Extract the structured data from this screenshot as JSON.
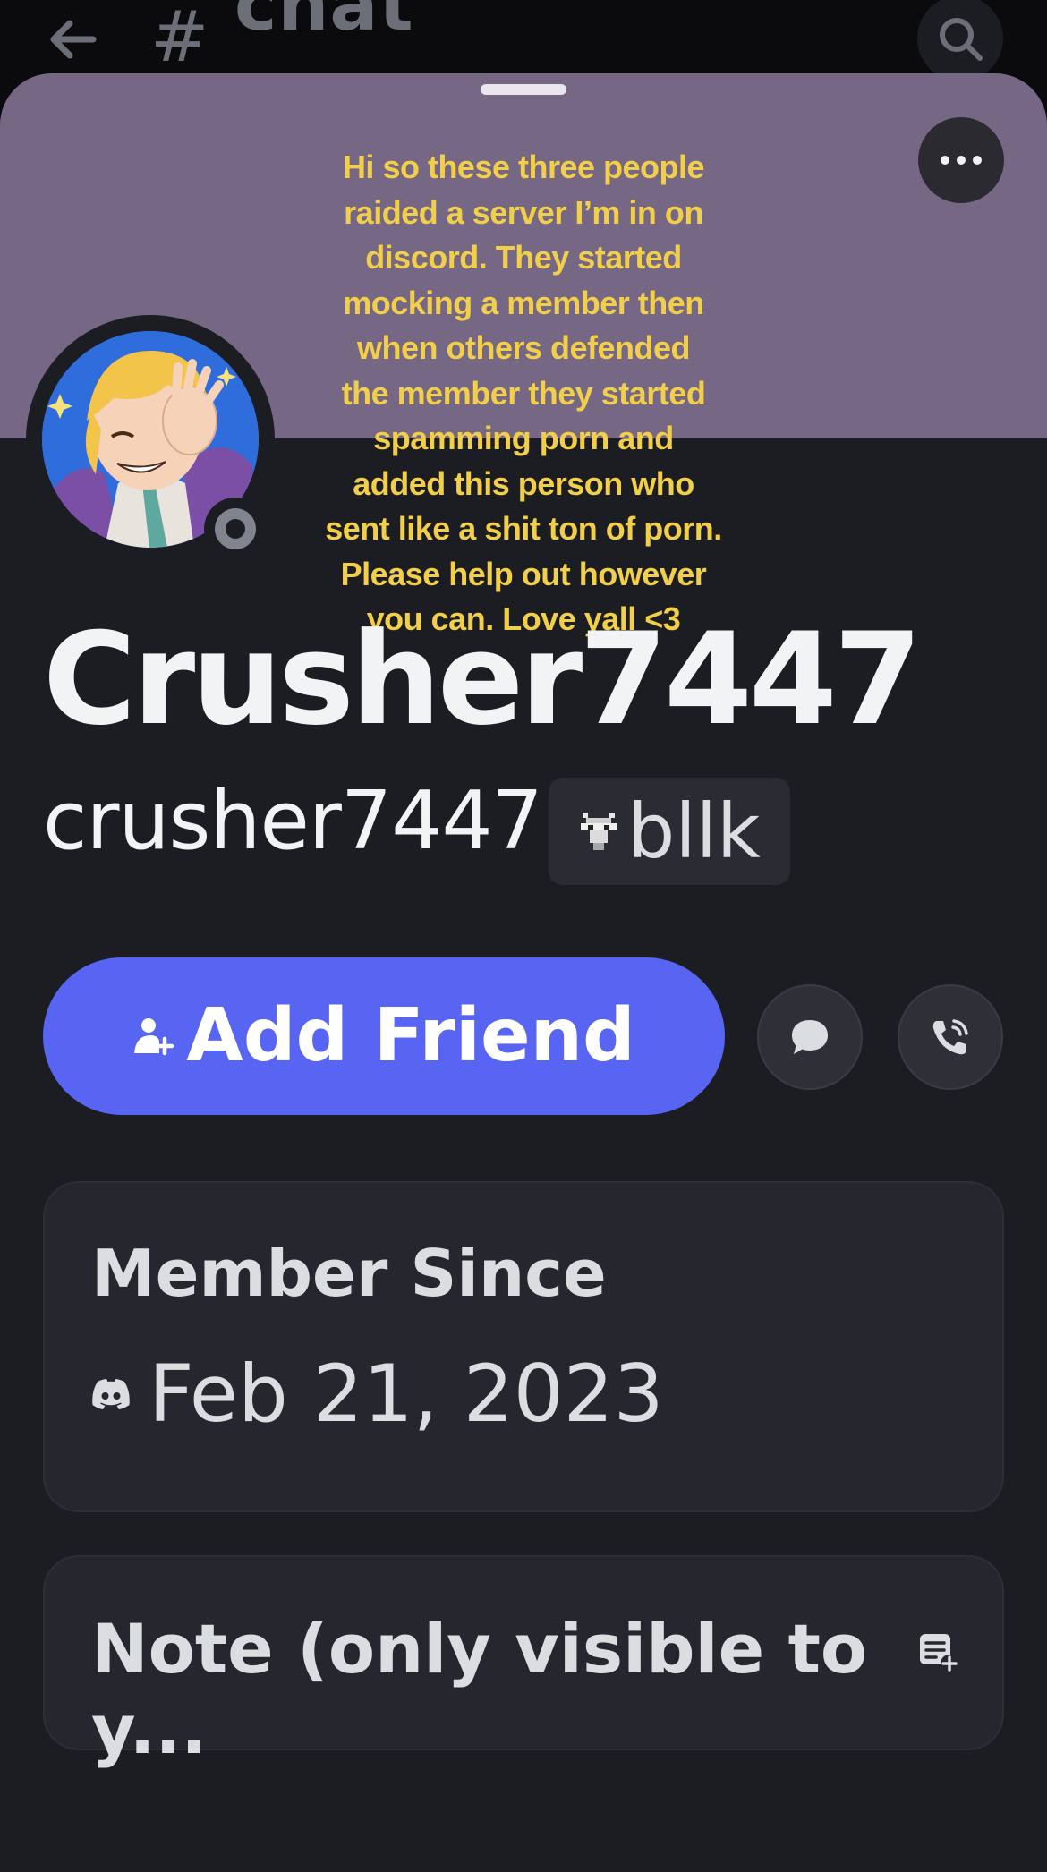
{
  "header": {
    "channel_symbol": "#",
    "channel_name": "chat"
  },
  "overlay_caption": "Hi so these three people\nraided a server I’m in on\ndiscord. They started\nmocking a member then\nwhen others defended\nthe member they started\nspamming porn and\nadded this person who\nsent like a shit ton of porn.\nPlease help out however\nyou can. Love yall <3",
  "profile": {
    "display_name": "Crusher7447",
    "username": "crusher7447",
    "tag_label": "bllk",
    "tag_icon": "goat-icon",
    "status": "offline",
    "banner_color": "#766884"
  },
  "actions": {
    "add_friend_label": "Add Friend",
    "message_icon": "chat-bubble-icon",
    "call_icon": "phone-call-icon",
    "accent_color": "#5865f2"
  },
  "member_since": {
    "title": "Member Since",
    "date": "Feb 21, 2023"
  },
  "note": {
    "title": "Note (only visible to y..."
  }
}
